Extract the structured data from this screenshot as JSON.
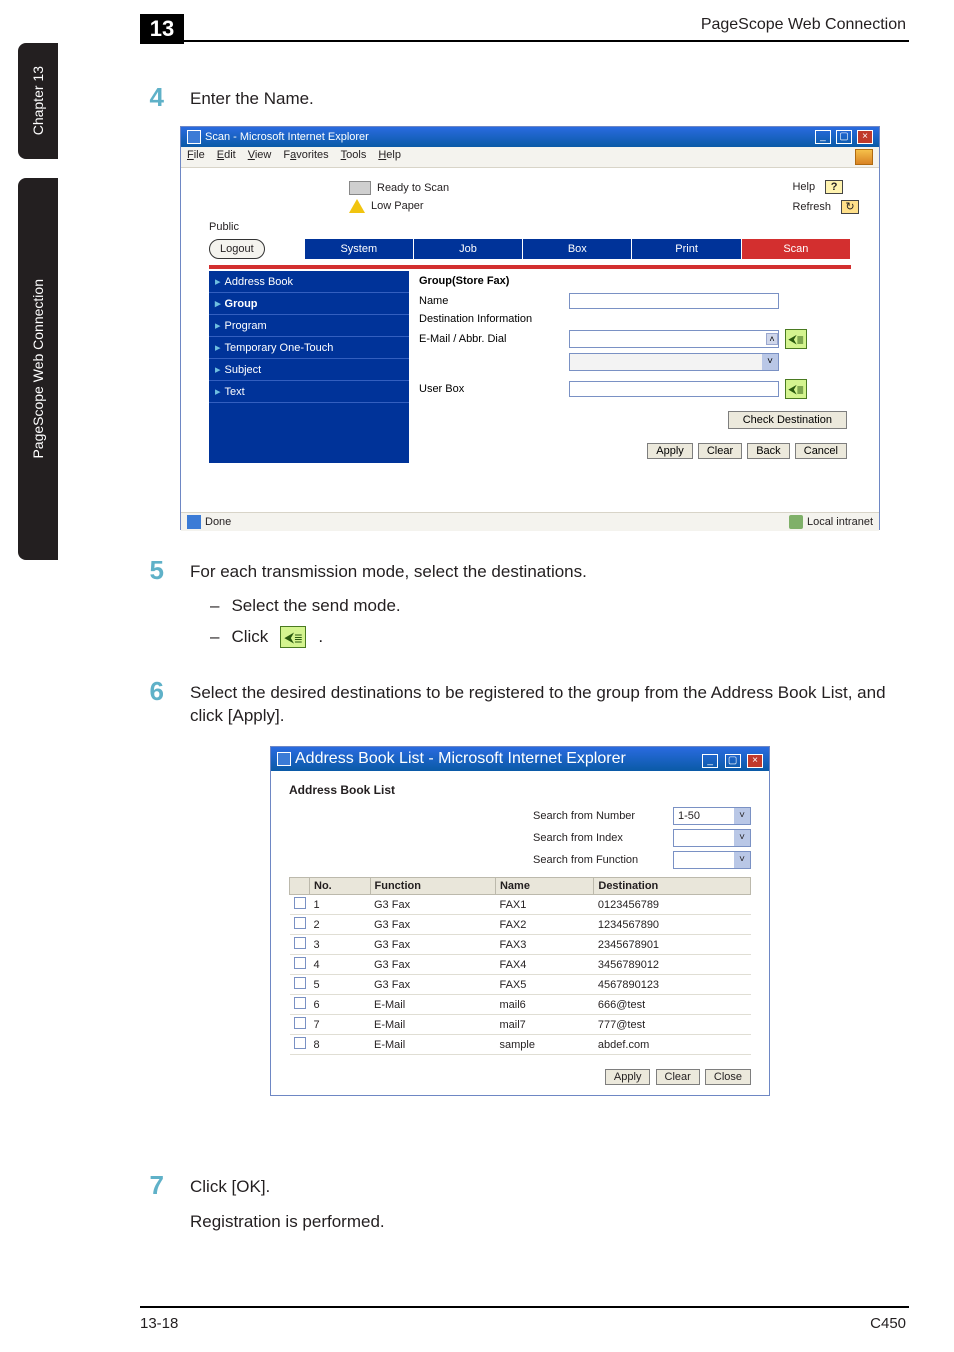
{
  "header": {
    "chapter_number": "13",
    "title": "PageScope Web Connection"
  },
  "side_tabs": {
    "small": "Chapter 13",
    "large": "PageScope Web Connection"
  },
  "steps": {
    "s4": {
      "num": "4",
      "text": "Enter the Name."
    },
    "s5": {
      "num": "5",
      "text": "For each transmission mode, select the destinations.",
      "sub_a": "Select the send mode.",
      "sub_b": "Click",
      "sub_b_post": "."
    },
    "s6": {
      "num": "6",
      "text": "Select the desired destinations to be registered to the group from the Address Book List, and click [Apply]."
    },
    "s7": {
      "num": "7",
      "text": "Click [OK].",
      "followup": "Registration is performed."
    }
  },
  "ie_main": {
    "title": "Scan - Microsoft Internet Explorer",
    "menu": [
      "File",
      "Edit",
      "View",
      "Favorites",
      "Tools",
      "Help"
    ],
    "status": {
      "ready": "Ready to Scan",
      "low_paper": "Low Paper",
      "help": "Help",
      "refresh": "Refresh",
      "public": "Public",
      "logout": "Logout"
    },
    "tabs": [
      "System",
      "Job",
      "Box",
      "Print",
      "Scan"
    ],
    "active_tab": "Scan",
    "side_items": [
      {
        "label": "Address Book",
        "active": false
      },
      {
        "label": "Group",
        "active": true
      },
      {
        "label": "Program",
        "active": false
      },
      {
        "label": "Temporary One-Touch",
        "active": false
      },
      {
        "label": "Subject",
        "active": false
      },
      {
        "label": "Text",
        "active": false
      }
    ],
    "form": {
      "heading": "Group(Store Fax)",
      "name_label": "Name",
      "name_value": "",
      "destinfo_label": "Destination Information",
      "email_label": "E-Mail / Abbr. Dial",
      "userbox_label": "User Box",
      "check_dest": "Check Destination",
      "buttons": [
        "Apply",
        "Clear",
        "Back",
        "Cancel"
      ]
    },
    "statusbar": {
      "done": "Done",
      "zone": "Local intranet"
    }
  },
  "dlg": {
    "title": "Address Book List - Microsoft Internet Explorer",
    "heading": "Address Book List",
    "search": {
      "number_label": "Search from Number",
      "number_value": "1-50",
      "index_label": "Search from Index",
      "function_label": "Search from Function"
    },
    "columns": {
      "no": "No.",
      "function": "Function",
      "name": "Name",
      "destination": "Destination"
    },
    "rows": [
      {
        "no": "1",
        "fn": "G3 Fax",
        "name": "FAX1",
        "dest": "0123456789"
      },
      {
        "no": "2",
        "fn": "G3 Fax",
        "name": "FAX2",
        "dest": "1234567890"
      },
      {
        "no": "3",
        "fn": "G3 Fax",
        "name": "FAX3",
        "dest": "2345678901"
      },
      {
        "no": "4",
        "fn": "G3 Fax",
        "name": "FAX4",
        "dest": "3456789012"
      },
      {
        "no": "5",
        "fn": "G3 Fax",
        "name": "FAX5",
        "dest": "4567890123"
      },
      {
        "no": "6",
        "fn": "E-Mail",
        "name": "mail6",
        "dest": "666@test"
      },
      {
        "no": "7",
        "fn": "E-Mail",
        "name": "mail7",
        "dest": "777@test"
      },
      {
        "no": "8",
        "fn": "E-Mail",
        "name": "sample",
        "dest": "abdef.com"
      }
    ],
    "buttons": [
      "Apply",
      "Clear",
      "Close"
    ]
  },
  "footer": {
    "left": "13-18",
    "right": "C450"
  }
}
